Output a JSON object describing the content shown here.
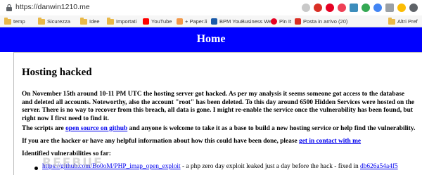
{
  "browser": {
    "url": "https://danwin1210.me",
    "bookmarks": [
      {
        "label": "temp",
        "icon": "folder-icon"
      },
      {
        "label": "Sicurezza",
        "icon": "folder-icon"
      },
      {
        "label": "Idee",
        "icon": "folder-icon"
      },
      {
        "label": "Importati",
        "icon": "folder-icon"
      },
      {
        "label": "YouTube",
        "icon": "youtube-icon"
      },
      {
        "label": "+ Paper.li",
        "icon": "paperli-icon"
      },
      {
        "label": "BPM YouBusiness We",
        "icon": "bpm-icon"
      },
      {
        "label": "Pin It",
        "icon": "pinterest-icon"
      },
      {
        "label": "Posta in arrivo (20)",
        "icon": "mail-icon"
      },
      {
        "label": "Altri Pref",
        "icon": "folder-icon"
      }
    ]
  },
  "page": {
    "header_title": "Home",
    "heading": "Hosting hacked",
    "p1_lines": [
      "On November 15th around 10-11 PM UTC the hosting server got hacked. As per my analysis it seems someone got access to the database",
      "and deleted all accounts. Noteworthy, also the account \"root\" has been deleted. To this day around 6500 Hidden Services were hosted on the",
      "server. There is no way to recover from this breach, all data is gone. I might re-enable the service once the vulnerability has been found, but",
      "right now I first need to find it."
    ],
    "p2_before": "The scripts are ",
    "p2_link": "open source on github",
    "p2_after": " and anyone is welcome to take it as a base to build a new hosting service or help find the vulnerability.",
    "p3_before": "If you are the hacker or have any helpful information about how this could have been done, please ",
    "p3_link": "get in contact with me",
    "identified": "Identified vulnerabilities so far:",
    "vuln_link": "https://github.com/Bo0oM/PHP_imap_open_exploit",
    "vuln_text": " - a php zero day exploit leaked just a day before the hack - fixed in ",
    "vuln_commit": "db626a54a4f5",
    "watermark": "REEBUF"
  },
  "colors": {
    "header_bg": "#0000ff",
    "link": "#0000ee"
  }
}
